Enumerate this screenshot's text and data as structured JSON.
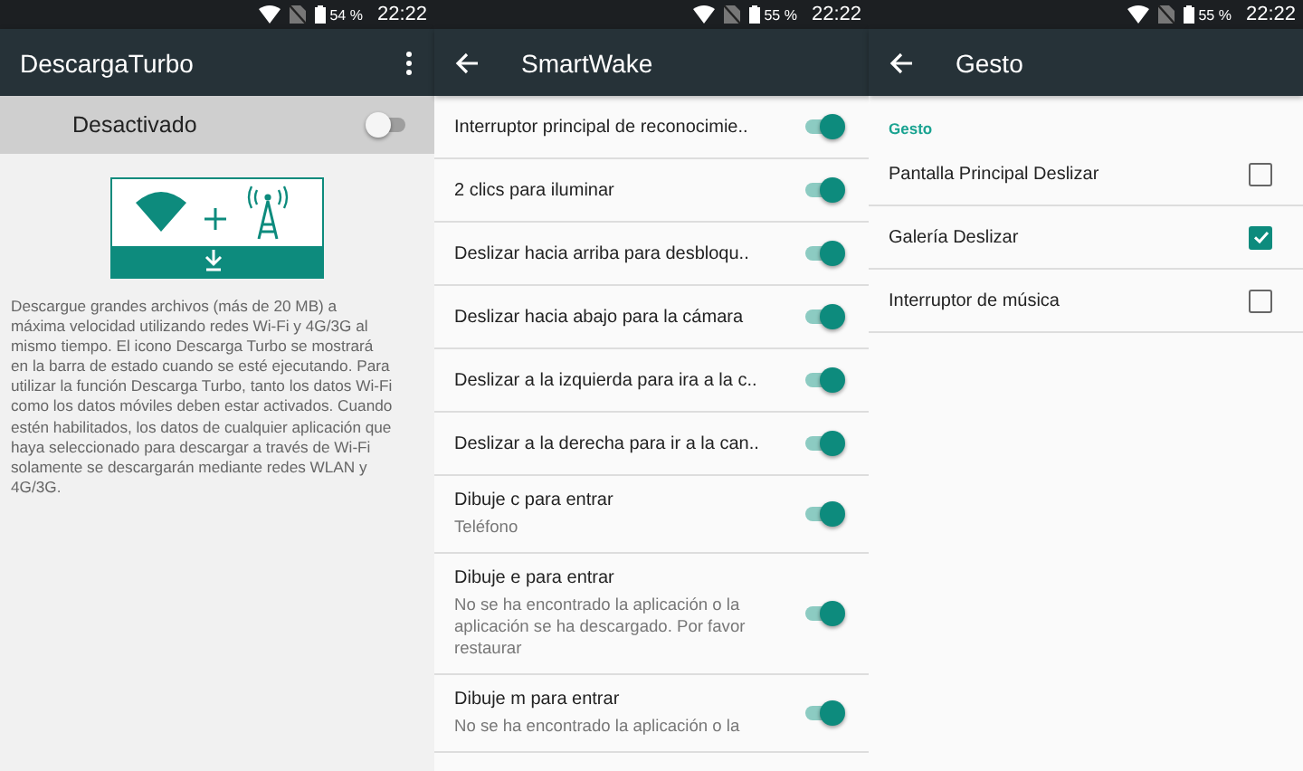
{
  "screens": [
    {
      "kind": "turbo",
      "status": {
        "battery": "54 %",
        "time": "22:22"
      },
      "title": "DescargaTurbo",
      "back": false,
      "menu": true,
      "master": {
        "label": "Desactivado",
        "on": false
      },
      "description": "Descargue grandes archivos (más de 20 MB) a máxima velocidad utilizando redes Wi-Fi y 4G/3G al mismo tiempo. El icono Descarga Turbo se mostrará en la barra de estado cuando se esté ejecutando. Para utilizar la función Descarga Turbo, tanto los datos Wi-Fi como los datos móviles deben estar activados. Cuando estén habilitados, los datos de cualquier aplicación que haya seleccionado para descargar a través de Wi-Fi solamente se descargarán mediante redes WLAN y 4G/3G."
    },
    {
      "kind": "toggles",
      "status": {
        "battery": "55 %",
        "time": "22:22"
      },
      "title": "SmartWake",
      "back": true,
      "menu": false,
      "items": [
        {
          "label": "Interruptor principal de reconocimie..",
          "on": true
        },
        {
          "label": "2 clics para iluminar",
          "on": true
        },
        {
          "label": "Deslizar hacia arriba para desbloqu..",
          "on": true
        },
        {
          "label": "Deslizar hacia abajo para la cámara",
          "on": true
        },
        {
          "label": "Deslizar a la izquierda para ira a la c..",
          "on": true
        },
        {
          "label": "Deslizar a la derecha para ir a la can..",
          "on": true
        },
        {
          "label": "Dibuje c para entrar",
          "sub": "Teléfono",
          "on": true
        },
        {
          "label": "Dibuje e para entrar",
          "sub": "No se ha encontrado la aplicación o la aplicación se ha descargado. Por favor restaurar",
          "on": true
        },
        {
          "label": "Dibuje m para entrar",
          "sub": "No se ha encontrado la aplicación o la",
          "on": true
        }
      ]
    },
    {
      "kind": "checks",
      "status": {
        "battery": "55 %",
        "time": "22:22"
      },
      "title": "Gesto",
      "back": true,
      "menu": false,
      "section": "Gesto",
      "items": [
        {
          "label": "Pantalla Principal Deslizar",
          "checked": false
        },
        {
          "label": "Galería Deslizar",
          "checked": true
        },
        {
          "label": "Interruptor de música",
          "checked": false
        }
      ]
    }
  ]
}
